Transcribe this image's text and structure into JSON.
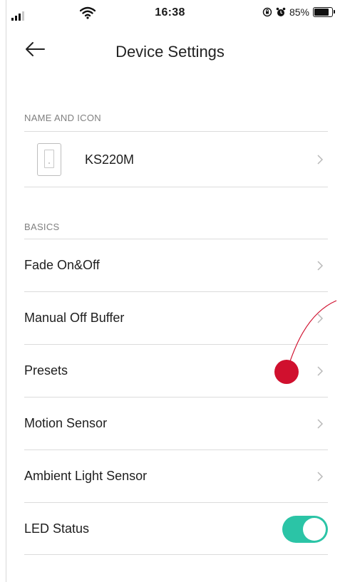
{
  "status_bar": {
    "time": "16:38",
    "battery_percent": "85%"
  },
  "header": {
    "title": "Device Settings"
  },
  "name_section": {
    "label": "NAME AND ICON",
    "device_name": "KS220M",
    "device_icon": "wall-switch-icon"
  },
  "basics_section": {
    "label": "BASICS",
    "items": [
      {
        "label": "Fade On&Off"
      },
      {
        "label": "Manual Off Buffer"
      },
      {
        "label": "Presets"
      },
      {
        "label": "Motion Sensor"
      },
      {
        "label": "Ambient Light Sensor"
      }
    ],
    "led": {
      "label": "LED Status",
      "enabled": true
    }
  },
  "colors": {
    "accent": "#2bc4a6",
    "annotation": "#d0102e"
  }
}
